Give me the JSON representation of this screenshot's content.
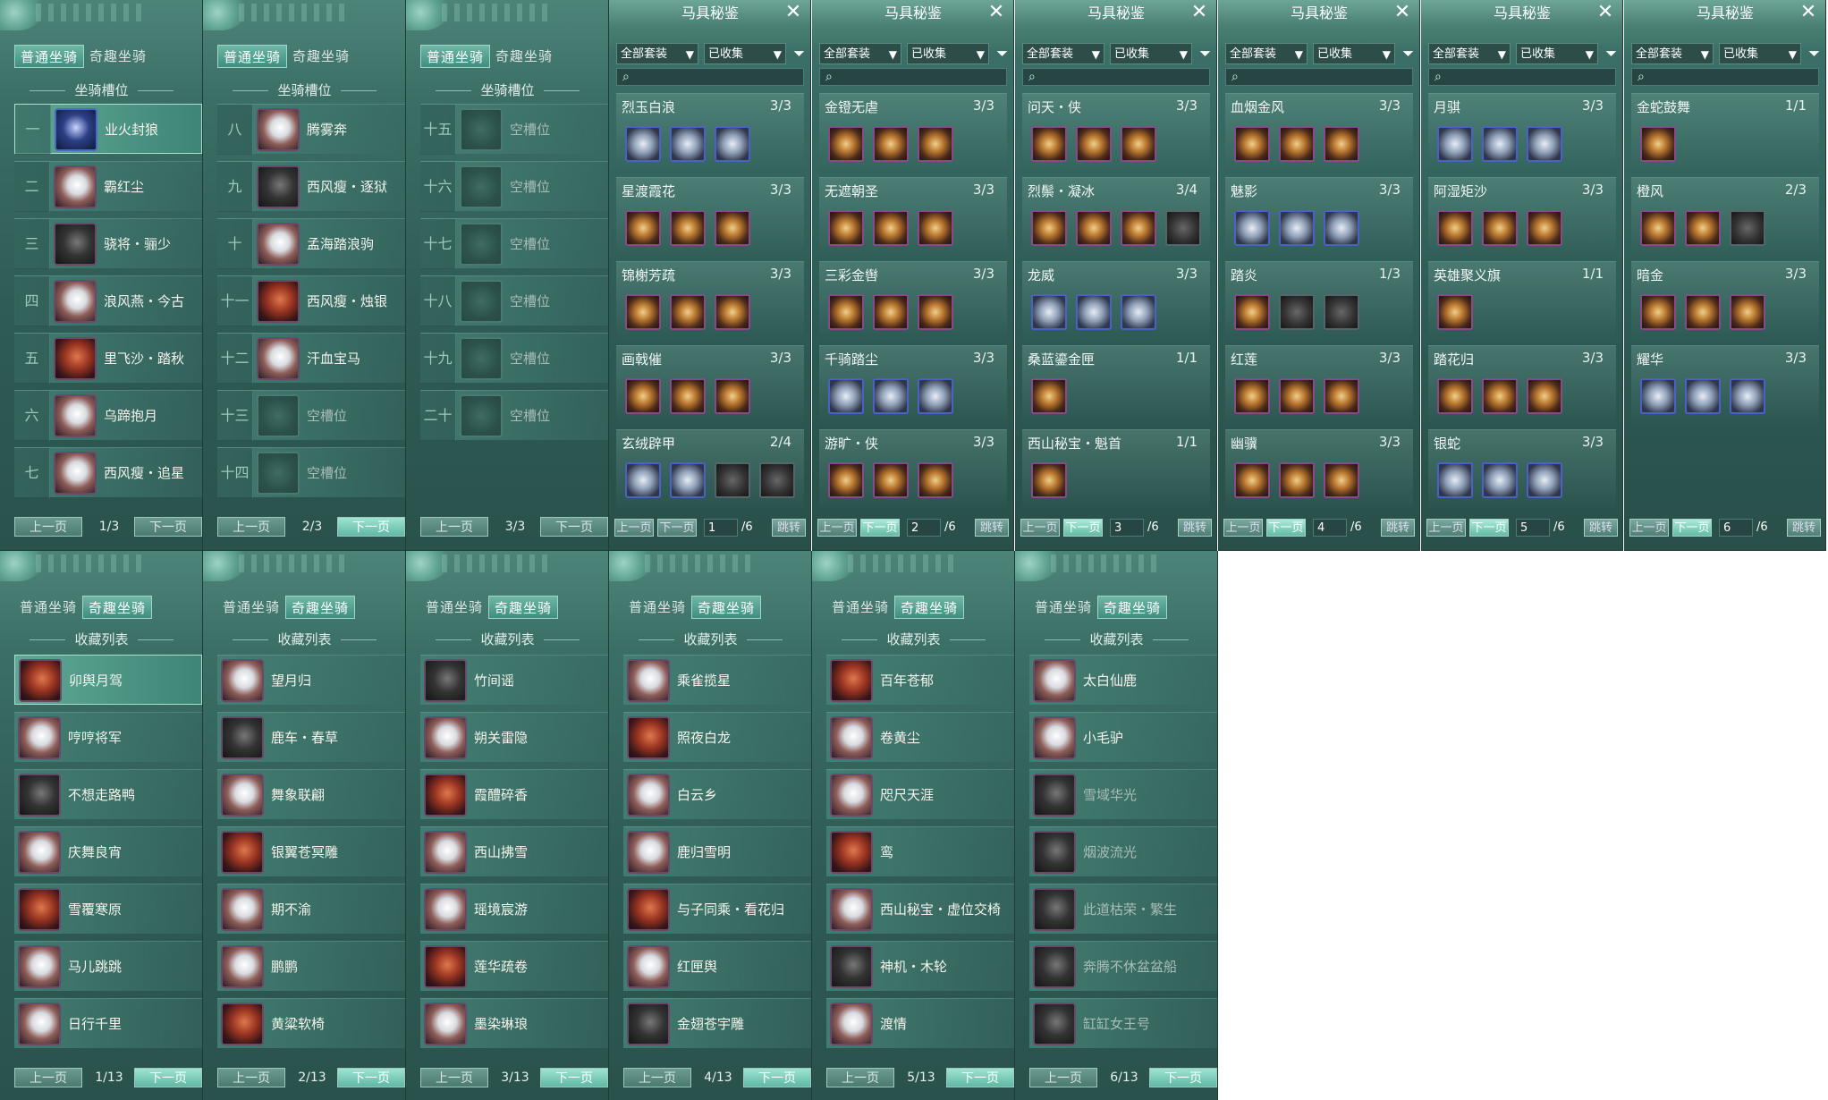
{
  "labels": {
    "tab_normal": "普通坐骑",
    "tab_fun": "奇趣坐骑",
    "slot_header": "坐骑槽位",
    "fav_header": "收藏列表",
    "prev": "上一页",
    "next": "下一页",
    "harness_title": "马具秘鉴",
    "all_sets": "全部套装",
    "collected": "已收集",
    "jump": "跳转",
    "close": "✕",
    "filter": "⏷",
    "search": "⌕"
  },
  "slot_pages": [
    {
      "count": "1/3",
      "rows": [
        {
          "n": "一",
          "name": "业火封狼",
          "sel": true
        },
        {
          "n": "二",
          "name": "霸红尘"
        },
        {
          "n": "三",
          "name": "骁将・骊少"
        },
        {
          "n": "四",
          "name": "浪风燕・今古"
        },
        {
          "n": "五",
          "name": "里飞沙・踏秋"
        },
        {
          "n": "六",
          "name": "乌蹄抱月"
        },
        {
          "n": "七",
          "name": "西风瘦・追星"
        }
      ]
    },
    {
      "count": "2/3",
      "rows": [
        {
          "n": "八",
          "name": "腾雾奔"
        },
        {
          "n": "九",
          "name": "西风瘦・逐狱"
        },
        {
          "n": "十",
          "name": "孟海踏浪驹"
        },
        {
          "n": "十一",
          "name": "西风瘦・烛银"
        },
        {
          "n": "十二",
          "name": "汗血宝马"
        },
        {
          "n": "十三",
          "name": "空槽位",
          "empty": true
        },
        {
          "n": "十四",
          "name": "空槽位",
          "empty": true
        }
      ]
    },
    {
      "count": "3/3",
      "rows": [
        {
          "n": "十五",
          "name": "空槽位",
          "empty": true
        },
        {
          "n": "十六",
          "name": "空槽位",
          "empty": true
        },
        {
          "n": "十七",
          "name": "空槽位",
          "empty": true
        },
        {
          "n": "十八",
          "name": "空槽位",
          "empty": true
        },
        {
          "n": "十九",
          "name": "空槽位",
          "empty": true
        },
        {
          "n": "二十",
          "name": "空槽位",
          "empty": true
        }
      ]
    }
  ],
  "harness_pages": [
    {
      "page": "1",
      "total": "/6",
      "sets": [
        {
          "name": "烈玉白浪",
          "count": "3/3"
        },
        {
          "name": "星渡霞花",
          "count": "3/3"
        },
        {
          "name": "锦榭芳疏",
          "count": "3/3"
        },
        {
          "name": "画戟催",
          "count": "3/3"
        },
        {
          "name": "玄绒辟甲",
          "count": "2/4"
        }
      ]
    },
    {
      "page": "2",
      "total": "/6",
      "sets": [
        {
          "name": "金镫无虐",
          "count": "3/3"
        },
        {
          "name": "无遮朝圣",
          "count": "3/3"
        },
        {
          "name": "三彩金辔",
          "count": "3/3"
        },
        {
          "name": "千骑踏尘",
          "count": "3/3"
        },
        {
          "name": "游旷・侠",
          "count": "3/3"
        }
      ]
    },
    {
      "page": "3",
      "total": "/6",
      "sets": [
        {
          "name": "问天・侠",
          "count": "3/3"
        },
        {
          "name": "烈鬃・凝冰",
          "count": "3/4"
        },
        {
          "name": "龙威",
          "count": "3/3"
        },
        {
          "name": "桑蓝鎏金匣",
          "count": "1/1"
        },
        {
          "name": "西山秘宝・魁首",
          "count": "1/1"
        }
      ]
    },
    {
      "page": "4",
      "total": "/6",
      "sets": [
        {
          "name": "血烟金风",
          "count": "3/3"
        },
        {
          "name": "魅影",
          "count": "3/3"
        },
        {
          "name": "踏炎",
          "count": "1/3"
        },
        {
          "name": "红莲",
          "count": "3/3"
        },
        {
          "name": "幽骥",
          "count": "3/3"
        }
      ]
    },
    {
      "page": "5",
      "total": "/6",
      "sets": [
        {
          "name": "月骐",
          "count": "3/3"
        },
        {
          "name": "阿湿矩沙",
          "count": "3/3"
        },
        {
          "name": "英雄聚义旗",
          "count": "1/1"
        },
        {
          "name": "踏花归",
          "count": "3/3"
        },
        {
          "name": "银蛇",
          "count": "3/3"
        }
      ]
    },
    {
      "page": "6",
      "total": "/6",
      "sets": [
        {
          "name": "金蛇鼓舞",
          "count": "1/1"
        },
        {
          "name": "橙风",
          "count": "2/3"
        },
        {
          "name": "暗金",
          "count": "3/3"
        },
        {
          "name": "耀华",
          "count": "3/3"
        }
      ]
    }
  ],
  "fav_pages": [
    {
      "count": "1/13",
      "rows": [
        "卯舆月驾",
        "哼哼将军",
        "不想走路鸭",
        "庆舞良宵",
        "雪覆寒原",
        "马儿跳跳",
        "日行千里"
      ]
    },
    {
      "count": "2/13",
      "rows": [
        "望月归",
        "鹿车・春草",
        "舞象联翩",
        "银翼苍冥雕",
        "期不渝",
        "鹏鹏",
        "黄粱软椅"
      ]
    },
    {
      "count": "3/13",
      "rows": [
        "竹间谣",
        "朔关雷隐",
        "霞醴碎香",
        "西山拂雪",
        "瑶境宸游",
        "莲华疏卷",
        "墨染琳琅"
      ]
    },
    {
      "count": "4/13",
      "rows": [
        "乘雀揽星",
        "照夜白龙",
        "白云乡",
        "鹿归雪明",
        "与子同乘・看花归",
        "红匣舆",
        "金翅苍宇雕"
      ]
    },
    {
      "count": "5/13",
      "rows": [
        "百年苍郁",
        "卷黄尘",
        "咫尺天涯",
        "鸾",
        "西山秘宝・虚位交椅",
        "神机・木轮",
        "渡情"
      ]
    },
    {
      "count": "6/13",
      "rows": [
        "太白仙鹿",
        "小毛驴",
        "雪域华光",
        "烟波流光",
        "此道枯荣・繁生",
        "奔腾不休盆盆船",
        "缸缸女王号"
      ],
      "dim": [
        2,
        3,
        4,
        5,
        6
      ]
    }
  ]
}
